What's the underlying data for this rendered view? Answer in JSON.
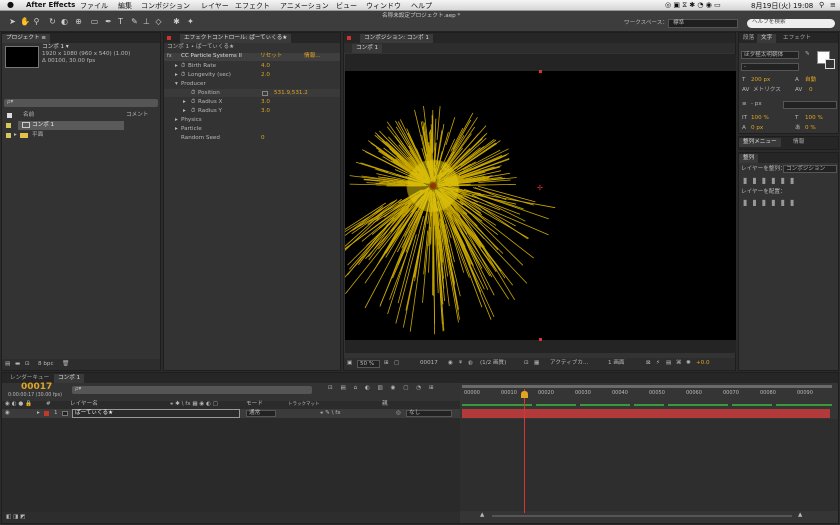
{
  "menubar": {
    "app": "After Effects",
    "items": [
      "ファイル",
      "編集",
      "コンポジション",
      "レイヤー",
      "エフェクト",
      "アニメーション",
      "ビュー",
      "ウィンドウ",
      "ヘルプ"
    ],
    "datetime": "8月19日(火) 19:08"
  },
  "toolbar": {
    "title": "名称未設定プロジェクト.aep *",
    "workspace_label": "ワークスペース：",
    "workspace_value": "標準",
    "search_placeholder": "ヘルプを検索"
  },
  "project": {
    "tab": "プロジェクト ≡",
    "comp_name": "コンポ 1 ▾",
    "comp_info1": "1920 x 1080  (960 x 540) (1.00)",
    "comp_info2": "Δ 00100, 30.00 fps",
    "search_placeholder": "ρ▾",
    "col_name": "名前",
    "col_comment": "コメント",
    "items": [
      "コンポ 1",
      "平面"
    ],
    "bpc": "8 bpc"
  },
  "effects": {
    "tab": "エフェクトコントロール: ぱーてぃくる★",
    "header": "コンポ 1 • ぱーてぃくる★",
    "effect_name": "CC Particle Systems II",
    "reset": "リセット",
    "about": "情報...",
    "rows": [
      {
        "label": "Birth Rate",
        "value": "4.0"
      },
      {
        "label": "Longevity (sec)",
        "value": "2.0"
      },
      {
        "label": "Producer",
        "value": ""
      },
      {
        "label": "Position",
        "value": "531.9,531.2"
      },
      {
        "label": "Radius X",
        "value": "3.0"
      },
      {
        "label": "Radius Y",
        "value": "3.0"
      },
      {
        "label": "Physics",
        "value": ""
      },
      {
        "label": "Particle",
        "value": ""
      },
      {
        "label": "Random Seed",
        "value": "0"
      }
    ]
  },
  "composition": {
    "tab": "コンポジション: コンポ 1",
    "subtab": "コンポ 1",
    "zoom": "50 %",
    "timecode": "00017",
    "resolution": "(1/2 画質)",
    "camera": "アクティブカ...",
    "views": "1 画面",
    "exposure": "+0.0"
  },
  "character": {
    "tabs": [
      "段落",
      "文字",
      "エフェクト"
    ],
    "font": "ほ夕極太明朝体",
    "font_style": "-",
    "size": "200 px",
    "leading": "自動",
    "kerning": "メトリクス",
    "tracking": "0",
    "stroke": "- px",
    "vscale": "100 %",
    "hscale": "100 %",
    "baseline": "0 px",
    "tsume": "0 %"
  },
  "align": {
    "smoother_tabs": [
      "整列メニュー",
      "情報"
    ],
    "tab": "整列",
    "align_to_label": "レイヤーを整列：",
    "align_to_value": "コンポジション",
    "distribute_label": "レイヤーを配置："
  },
  "timeline": {
    "tabs": [
      "レンダーキュー",
      "コンポ 1"
    ],
    "current_time": "00017",
    "time_sub": "0:00:00:17 (30.00 fps)",
    "search_placeholder": "ρ▾",
    "col_source": "レイヤー名",
    "col_mode": "モード",
    "col_trkmat": "トラックマット",
    "col_parent": "親",
    "layer": {
      "num": "1",
      "name": "ぱーてぃくる★",
      "mode": "通常",
      "parent": "なし"
    },
    "ruler": [
      "00000",
      "00010",
      "00020",
      "00030",
      "00040",
      "00050",
      "00060",
      "00070",
      "00080",
      "00090"
    ]
  },
  "colors": {
    "accent": "#e0a522",
    "layer_red": "#c0392b",
    "particle": "#d4b800"
  }
}
